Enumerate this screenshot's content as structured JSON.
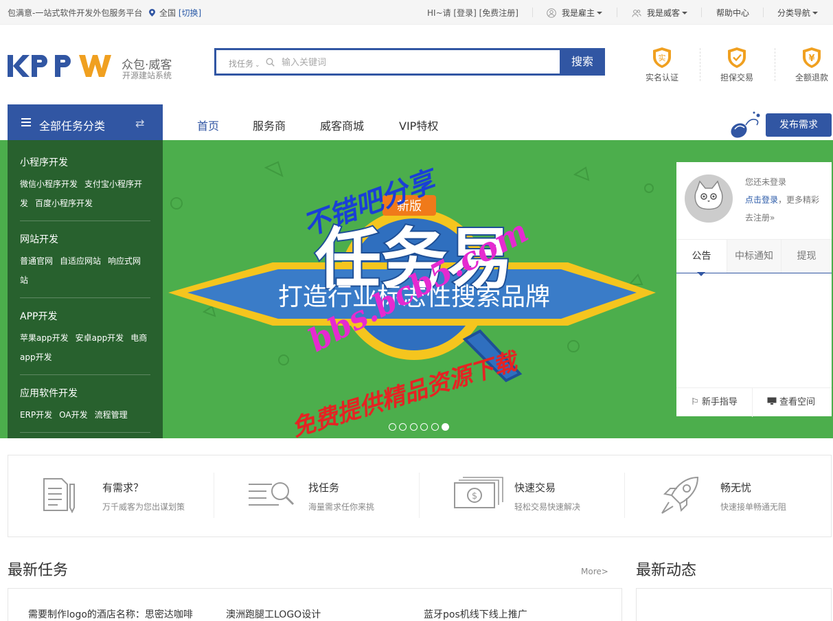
{
  "topbar": {
    "site_slogan": "包满意-一站式软件开发外包服务平台",
    "region": "全国",
    "region_switch": "[切换]",
    "greeting": "HI~请 [登录] [免费注册]",
    "employer": "我是雇主",
    "worker": "我是威客",
    "help": "帮助中心",
    "category_nav": "分类导航"
  },
  "header": {
    "logo_text": "KPPW",
    "logo_sub1": "众包·威客",
    "logo_sub2": "开源建站系统",
    "search": {
      "category": "找任务",
      "placeholder": "输入关键词",
      "button": "搜索"
    },
    "badges": [
      {
        "label": "实名认证",
        "glyph": "实",
        "icon": "verified-shield-icon"
      },
      {
        "label": "担保交易",
        "glyph": "✓",
        "icon": "guarantee-shield-icon"
      },
      {
        "label": "全额退款",
        "glyph": "¥",
        "icon": "refund-shield-icon"
      }
    ]
  },
  "nav": {
    "category_title": "全部任务分类",
    "items": [
      "首页",
      "服务商",
      "威客商城",
      "VIP特权"
    ],
    "active": "首页",
    "publish": "发布需求"
  },
  "sidebar": [
    {
      "title": "小程序开发",
      "items": [
        "微信小程序开发",
        "支付宝小程序开发",
        "百度小程序开发"
      ]
    },
    {
      "title": "网站开发",
      "items": [
        "普通官网",
        "自适应网站",
        "响应式网站"
      ]
    },
    {
      "title": "APP开发",
      "items": [
        "苹果app开发",
        "安卓app开发",
        "电商app开发"
      ]
    },
    {
      "title": "应用软件开发",
      "items": [
        "ERP开发",
        "OA开发",
        "流程管理"
      ]
    }
  ],
  "banner": {
    "tag": "新版",
    "headline": "任务易",
    "slogan": "打造行业标志性搜索品牌",
    "slide_count": 6,
    "active_slide": 6,
    "colors": {
      "background": "#4cae4c",
      "ribbon": "#3a7cc8",
      "gold": "#f5c51e",
      "tag": "#f07a1a"
    }
  },
  "watermark": {
    "line1": "不错吧分享",
    "line2": "bbs.bcb5.com",
    "line3": "免费提供精品资源下载"
  },
  "user_panel": {
    "not_logged": "您还未登录",
    "login_link": "点击登录",
    "more_text": "，更多精彩",
    "register": "去注册»",
    "tabs": [
      "公告",
      "中标通知",
      "提现"
    ],
    "guide": "新手指导",
    "space": "查看空间"
  },
  "features": [
    {
      "title": "有需求？",
      "desc": "万千威客为您出谋划策",
      "icon": "document-icon"
    },
    {
      "title": "找任务",
      "desc": "海量需求任你来挑",
      "icon": "search-list-icon"
    },
    {
      "title": "快速交易",
      "desc": "轻松交易快速解决",
      "icon": "money-icon"
    },
    {
      "title": "畅无忧",
      "desc": "快速接单畅通无阻",
      "icon": "rocket-icon"
    }
  ],
  "latest_tasks": {
    "title": "最新任务",
    "more": "More>",
    "items": [
      "需要制作logo的酒店名称：思密达咖啡",
      "澳洲跑腿工LOGO设计",
      "蓝牙pos机线下线上推广"
    ]
  },
  "latest_news": {
    "title": "最新动态"
  },
  "colors": {
    "primary": "#3156a3",
    "accent_orange": "#f0a020"
  }
}
